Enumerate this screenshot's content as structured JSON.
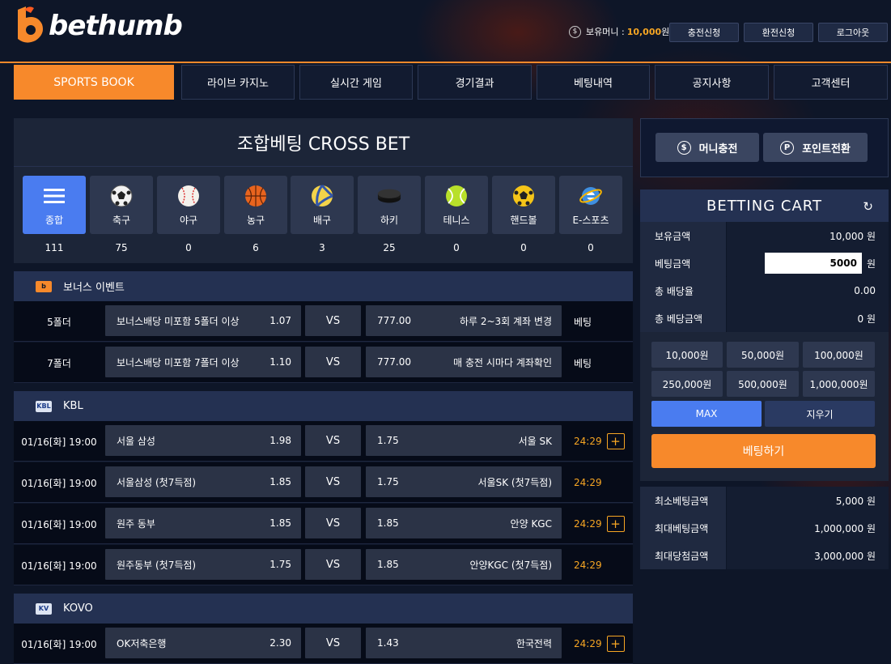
{
  "brand": {
    "name": "bethumb"
  },
  "header": {
    "wallet_label": "보유머니 :",
    "wallet_amount": "10,000",
    "wallet_unit": "원",
    "buttons": [
      "충전신청",
      "환전신청",
      "로그아웃"
    ]
  },
  "nav": [
    "SPORTS BOOK",
    "라이브 카지노",
    "실시간 게임",
    "경기결과",
    "베팅내역",
    "공지사항",
    "고객센터"
  ],
  "cross": {
    "title": "조합베팅 CROSS BET"
  },
  "sports": [
    {
      "label": "종합",
      "count": "111",
      "icon": "menu-icon"
    },
    {
      "label": "축구",
      "count": "75",
      "icon": "soccer-ball-icon"
    },
    {
      "label": "야구",
      "count": "0",
      "icon": "baseball-icon"
    },
    {
      "label": "농구",
      "count": "6",
      "icon": "basketball-icon"
    },
    {
      "label": "배구",
      "count": "3",
      "icon": "volleyball-icon"
    },
    {
      "label": "하키",
      "count": "25",
      "icon": "hockey-puck-icon"
    },
    {
      "label": "테니스",
      "count": "0",
      "icon": "tennis-ball-icon"
    },
    {
      "label": "핸드볼",
      "count": "0",
      "icon": "handball-icon"
    },
    {
      "label": "E-스포츠",
      "count": "0",
      "icon": "esports-icon"
    }
  ],
  "sections": {
    "bonus": {
      "title": "보너스 이벤트",
      "rows": [
        {
          "lead": "5폴더",
          "home": "보너스배당 미포함 5폴더 이상",
          "home_odd": "1.07",
          "vs": "VS",
          "away_odd": "777.00",
          "away": "하루 2~3회 계좌 변경",
          "tail": "베팅"
        },
        {
          "lead": "7폴더",
          "home": "보너스배당 미포함 7폴더 이상",
          "home_odd": "1.10",
          "vs": "VS",
          "away_odd": "777.00",
          "away": "매 충전 시마다 계좌확인",
          "tail": "베팅"
        }
      ]
    },
    "kbl": {
      "title": "KBL",
      "rows": [
        {
          "lead": "01/16[화] 19:00",
          "home": "서울 삼성",
          "home_odd": "1.98",
          "vs": "VS",
          "away_odd": "1.75",
          "away": "서울 SK",
          "tail": "24:29",
          "plus": "+"
        },
        {
          "lead": "01/16[화] 19:00",
          "home": "서울삼성 (첫7득점)",
          "home_odd": "1.85",
          "vs": "VS",
          "away_odd": "1.75",
          "away": "서울SK (첫7득점)",
          "tail": "24:29"
        },
        {
          "lead": "01/16[화] 19:00",
          "home": "원주 동부",
          "home_odd": "1.85",
          "vs": "VS",
          "away_odd": "1.85",
          "away": "안양 KGC",
          "tail": "24:29",
          "plus": "+"
        },
        {
          "lead": "01/16[화] 19:00",
          "home": "원주동부 (첫7득점)",
          "home_odd": "1.75",
          "vs": "VS",
          "away_odd": "1.85",
          "away": "안양KGC (첫7득점)",
          "tail": "24:29"
        }
      ]
    },
    "kovo": {
      "title": "KOVO",
      "rows": [
        {
          "lead": "01/16[화] 19:00",
          "home": "OK저축은행",
          "home_odd": "2.30",
          "vs": "VS",
          "away_odd": "1.43",
          "away": "한국전력",
          "tail": "24:29",
          "plus": "+"
        }
      ]
    }
  },
  "charge": {
    "money": "머니충전",
    "point": "포인트전환"
  },
  "cart": {
    "title": "BETTING CART",
    "rows": [
      {
        "label": "보유금액",
        "value": "10,000 원"
      },
      {
        "label": "베팅금액",
        "value": "5000",
        "unit": "원"
      },
      {
        "label": "총 배당율",
        "value": "0.00"
      },
      {
        "label": "총 베당금액",
        "value": "0 원"
      }
    ],
    "amounts": [
      "10,000원",
      "50,000원",
      "100,000원",
      "250,000원",
      "500,000원",
      "1,000,000원"
    ],
    "max": "MAX",
    "clear": "지우기",
    "submit": "베팅하기"
  },
  "limits": [
    {
      "label": "최소베팅금액",
      "value": "5,000 원"
    },
    {
      "label": "최대베팅금액",
      "value": "1,000,000 원"
    },
    {
      "label": "최대당첨금액",
      "value": "3,000,000 원"
    }
  ],
  "colors": {
    "accent": "#f7892b",
    "blue": "#4a7cf0",
    "time": "#f7a623",
    "bg": "#0e1628"
  }
}
